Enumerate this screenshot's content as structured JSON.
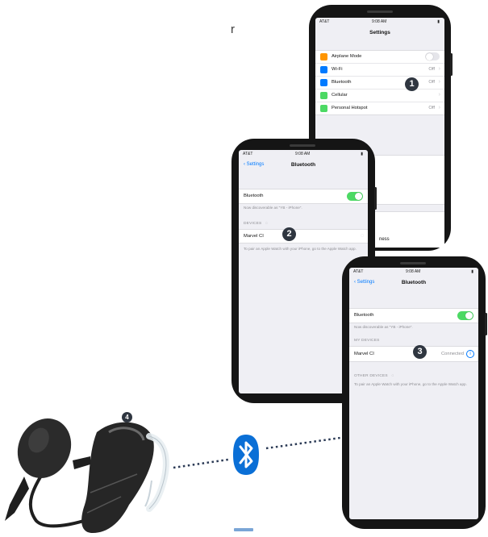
{
  "heading_fragment": "r",
  "phone1": {
    "status": {
      "carrier": "AT&T",
      "time": "9:08 AM"
    },
    "title": "Settings",
    "rows": [
      {
        "label": "Airplane Mode",
        "value": "",
        "icon_color": "#ff9500",
        "icon": "airplane-icon"
      },
      {
        "label": "Wi-Fi",
        "value": "Off",
        "icon_color": "#007aff",
        "icon": "wifi-icon"
      },
      {
        "label": "Bluetooth",
        "value": "Off",
        "icon_color": "#007aff",
        "icon": "bluetooth-icon"
      },
      {
        "label": "Cellular",
        "value": "",
        "icon_color": "#4cd964",
        "icon": "cellular-icon"
      },
      {
        "label": "Personal Hotspot",
        "value": "Off",
        "icon_color": "#4cd964",
        "icon": "hotspot-icon"
      }
    ],
    "airplane_mode_on": false,
    "badge": "1"
  },
  "phone2": {
    "status": {
      "carrier": "AT&T",
      "time": "9:08 AM"
    },
    "back": "Settings",
    "title": "Bluetooth",
    "bluetooth_label": "Bluetooth",
    "bluetooth_on": true,
    "discoverable_note": "Now discoverable as \"YB - iPhone\".",
    "devices_header": "DEVICES",
    "device_label": "Marvel CI",
    "pair_note": "To pair an Apple Watch with your iPhone, go to the Apple Watch app.",
    "badge": "2",
    "stray_text": "ness"
  },
  "phone3": {
    "status": {
      "carrier": "AT&T",
      "time": "9:08 AM"
    },
    "back": "Settings",
    "title": "Bluetooth",
    "bluetooth_label": "Bluetooth",
    "bluetooth_on": true,
    "discoverable_note": "Now discoverable as \"YB - iPhone\".",
    "my_devices_header": "MY DEVICES",
    "device_label": "Marvel CI",
    "device_status": "Connected",
    "other_devices_header": "OTHER DEVICES",
    "pair_note": "To pair an Apple Watch with your iPhone, go to the Apple Watch app.",
    "badge": "3"
  },
  "processor": {
    "badge": "4"
  },
  "bluetooth_logo": {
    "icon": "bluetooth-logo-icon",
    "color": "#0a6fd6"
  },
  "colors": {
    "ios_green": "#4cd964",
    "ios_blue": "#007aff",
    "badge_bg": "#2f3640",
    "dots": "#2b3a55"
  }
}
